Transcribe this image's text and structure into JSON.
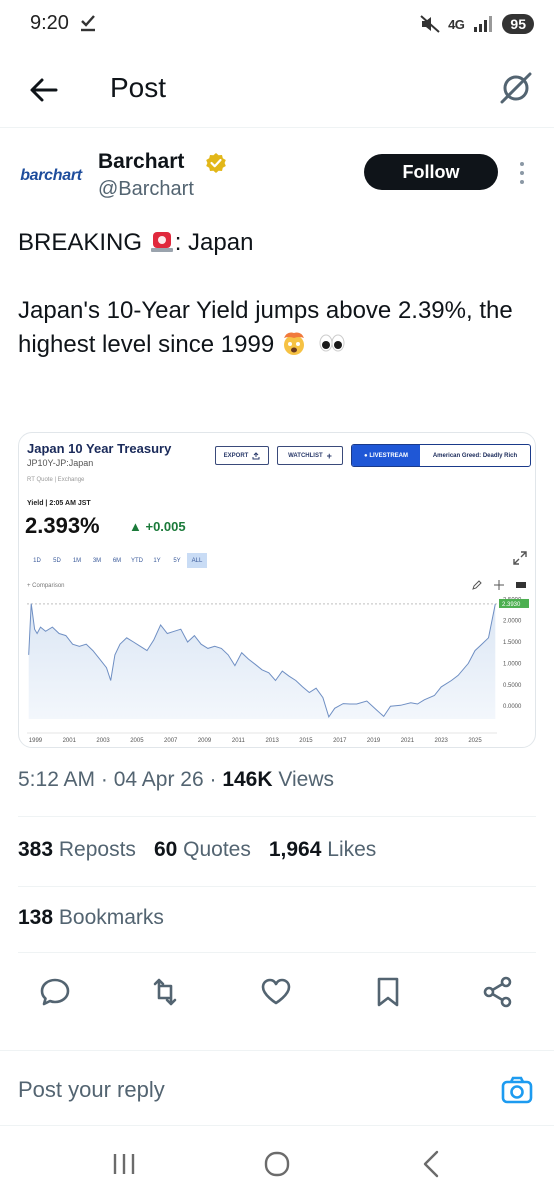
{
  "status_bar": {
    "time": "9:20",
    "network": "4G",
    "battery": "95"
  },
  "header": {
    "title": "Post"
  },
  "author": {
    "avatar_text": "barchart",
    "name": "Barchart",
    "handle": "@Barchart",
    "follow_label": "Follow"
  },
  "tweet": {
    "line1_prefix": "BREAKING",
    "line1_suffix": ": Japan",
    "line2": "Japan's 10-Year Yield jumps above 2.39%, the highest level since 1999"
  },
  "chart_card": {
    "title": "Japan 10 Year Treasury",
    "symbol": "JP10Y-JP:Japan",
    "quote_note": "RT Quote | Exchange",
    "yield_label": "Yield | 2:05 AM JST",
    "value": "2.393%",
    "change": "+0.005",
    "export_label": "EXPORT",
    "watchlist_label": "WATCHLIST",
    "livestream_label": "LIVESTREAM",
    "promo_label": "American Greed: Deadly Rich",
    "comparison_label": "Comparison",
    "ranges": [
      "1D",
      "5D",
      "1M",
      "3M",
      "6M",
      "YTD",
      "1Y",
      "5Y",
      "ALL"
    ],
    "active_range": "ALL",
    "current_tag": "2.3930"
  },
  "chart_data": {
    "type": "area",
    "title": "Japan 10 Year Treasury",
    "xlabel": "",
    "ylabel": "",
    "x_ticks": [
      "1999",
      "2001",
      "2003",
      "2005",
      "2007",
      "2009",
      "2011",
      "2013",
      "2015",
      "2017",
      "2019",
      "2021",
      "2023",
      "2025"
    ],
    "y_ticks": [
      "0.0000",
      "0.5000",
      "1.0000",
      "1.5000",
      "2.0000",
      "2.5000"
    ],
    "ylim": [
      -0.3,
      2.6
    ],
    "xlim": [
      1998.5,
      2026.3
    ],
    "series": [
      {
        "x": [
          1998.6,
          1998.75,
          1998.95,
          1999.1,
          1999.3,
          1999.6,
          2000.0,
          2000.4,
          2000.8,
          2001.2,
          2001.6,
          2002.0,
          2002.4,
          2002.8,
          2003.2,
          2003.45,
          2003.7,
          2004.0,
          2004.4,
          2004.8,
          2005.2,
          2005.6,
          2006.0,
          2006.4,
          2006.8,
          2007.2,
          2007.6,
          2008.0,
          2008.4,
          2008.8,
          2009.2,
          2009.6,
          2010.0,
          2010.4,
          2010.8,
          2011.2,
          2011.6,
          2012.0,
          2012.4,
          2012.8,
          2013.2,
          2013.6,
          2014.0,
          2014.4,
          2014.8,
          2015.2,
          2015.6,
          2016.0,
          2016.35,
          2016.7,
          2017.2,
          2017.6,
          2018.0,
          2018.6,
          2019.2,
          2019.6,
          2020.0,
          2020.6,
          2021.2,
          2021.6,
          2022.0,
          2022.6,
          2023.0,
          2023.6,
          2024.0,
          2024.6,
          2025.0,
          2025.4,
          2025.8,
          2026.2
        ],
        "values": [
          1.2,
          2.4,
          1.8,
          1.7,
          1.85,
          1.75,
          1.85,
          1.7,
          1.65,
          1.45,
          1.4,
          1.45,
          1.3,
          1.1,
          0.9,
          0.6,
          1.2,
          1.45,
          1.6,
          1.5,
          1.4,
          1.3,
          1.55,
          1.9,
          1.7,
          1.75,
          1.8,
          1.5,
          1.65,
          1.45,
          1.35,
          1.4,
          1.35,
          1.2,
          0.95,
          1.25,
          1.1,
          0.98,
          0.85,
          0.78,
          0.6,
          0.82,
          0.7,
          0.6,
          0.45,
          0.32,
          0.42,
          0.2,
          -0.25,
          -0.05,
          0.06,
          0.05,
          0.05,
          0.12,
          -0.1,
          -0.24,
          0.0,
          0.02,
          0.08,
          0.05,
          0.15,
          0.25,
          0.45,
          0.6,
          0.72,
          1.0,
          1.3,
          1.45,
          1.6,
          2.39
        ]
      }
    ],
    "grid": false,
    "legend": "none"
  },
  "meta": {
    "time": "5:12 AM",
    "date": "04 Apr 26",
    "views_count": "146K",
    "views_label": "Views"
  },
  "stats": {
    "reposts_count": "383",
    "reposts_label": "Reposts",
    "quotes_count": "60",
    "quotes_label": "Quotes",
    "likes_count": "1,964",
    "likes_label": "Likes",
    "bookmarks_count": "138",
    "bookmarks_label": "Bookmarks"
  },
  "reply": {
    "placeholder": "Post your reply"
  },
  "colors": {
    "accent": "#1d9bf0",
    "text": "#0f1419",
    "muted": "#536471",
    "chart_line": "#6f8fc3",
    "chart_fill": "#dbe6f4"
  }
}
